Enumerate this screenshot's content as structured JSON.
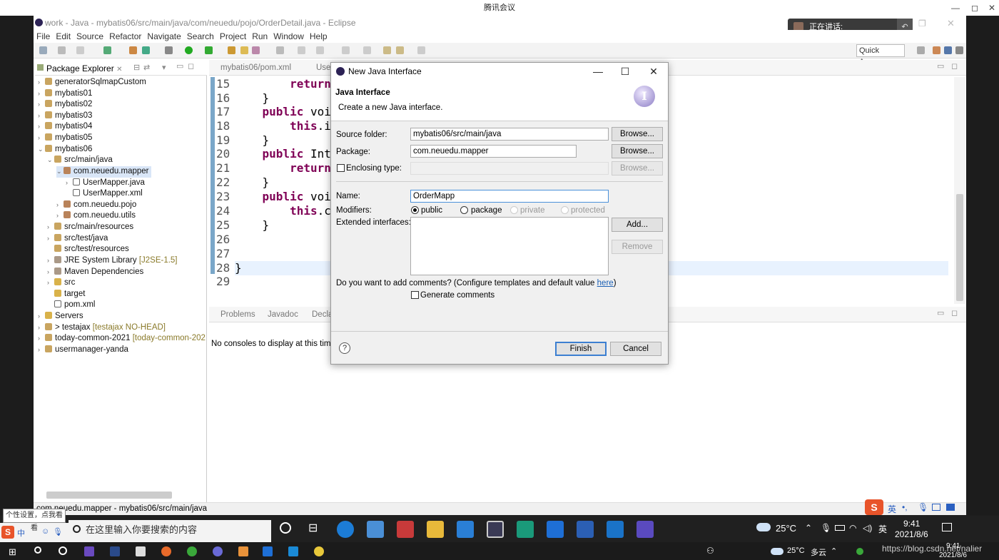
{
  "meeting": {
    "title": "腾讯会议",
    "speaking_label": "正在讲话:"
  },
  "window": {
    "title": "work - Java - mybatis06/src/main/java/com/neuedu/pojo/OrderDetail.java - Eclipse",
    "menu": [
      "File",
      "Edit",
      "Source",
      "Refactor",
      "Navigate",
      "Search",
      "Project",
      "Run",
      "Window",
      "Help"
    ],
    "quick_access": "Quick Access"
  },
  "package_explorer": {
    "tab_label": "Package Explorer",
    "items": [
      {
        "label": "generatorSqlmapCustom",
        "deco": ""
      },
      {
        "label": "mybatis01",
        "deco": ""
      },
      {
        "label": "mybatis02",
        "deco": ""
      },
      {
        "label": "mybatis03",
        "deco": ""
      },
      {
        "label": "mybatis04",
        "deco": ""
      },
      {
        "label": "mybatis05",
        "deco": ""
      },
      {
        "label": "mybatis06",
        "deco": ""
      },
      {
        "label": "src/main/java",
        "deco": ""
      },
      {
        "label": "com.neuedu.mapper",
        "deco": ""
      },
      {
        "label": "UserMapper.java",
        "deco": ""
      },
      {
        "label": "UserMapper.xml",
        "deco": ""
      },
      {
        "label": "com.neuedu.pojo",
        "deco": ""
      },
      {
        "label": "com.neuedu.utils",
        "deco": ""
      },
      {
        "label": "src/main/resources",
        "deco": ""
      },
      {
        "label": "src/test/java",
        "deco": ""
      },
      {
        "label": "src/test/resources",
        "deco": ""
      },
      {
        "label": "JRE System Library",
        "deco": "[J2SE-1.5]"
      },
      {
        "label": "Maven Dependencies",
        "deco": ""
      },
      {
        "label": "src",
        "deco": ""
      },
      {
        "label": "target",
        "deco": ""
      },
      {
        "label": "pom.xml",
        "deco": ""
      },
      {
        "label": "Servers",
        "deco": ""
      },
      {
        "label": "> testajax",
        "deco": "[testajax NO-HEAD]"
      },
      {
        "label": "today-common-2021",
        "deco": "[today-common-202"
      },
      {
        "label": "usermanager-yanda",
        "deco": ""
      }
    ]
  },
  "editor": {
    "tabs": [
      "mybatis06/pom.xml",
      "User"
    ],
    "lines": [
      {
        "n": "15",
        "code": "        return"
      },
      {
        "n": "16",
        "code": "    }"
      },
      {
        "n": "17",
        "code": "    public voi"
      },
      {
        "n": "18",
        "code": "        this.i"
      },
      {
        "n": "19",
        "code": "    }"
      },
      {
        "n": "20",
        "code": "    public Int"
      },
      {
        "n": "21",
        "code": "        return"
      },
      {
        "n": "22",
        "code": "    }"
      },
      {
        "n": "23",
        "code": "    public voi"
      },
      {
        "n": "24",
        "code": "        this.c"
      },
      {
        "n": "25",
        "code": "    }"
      },
      {
        "n": "26",
        "code": ""
      },
      {
        "n": "27",
        "code": ""
      },
      {
        "n": "28",
        "code": "}"
      },
      {
        "n": "29",
        "code": ""
      }
    ]
  },
  "console": {
    "tabs": [
      "Problems",
      "Javadoc",
      "Decla"
    ],
    "message": "No consoles to display at this time"
  },
  "status_bar": {
    "text": "com.neuedu.mapper - mybatis06/src/main/java"
  },
  "dialog": {
    "title": "New Java Interface",
    "heading": "Java Interface",
    "description": "Create a new Java interface.",
    "source_folder_label": "Source folder:",
    "source_folder_value": "mybatis06/src/main/java",
    "package_label": "Package:",
    "package_value": "com.neuedu.mapper",
    "enclosing_label": "Enclosing type:",
    "browse": "Browse...",
    "name_label": "Name:",
    "name_value": "OrderMapp",
    "modifiers_label": "Modifiers:",
    "modifiers": [
      "public",
      "package",
      "private",
      "protected"
    ],
    "extended_label": "Extended interfaces:",
    "add_label": "Add...",
    "remove_label": "Remove",
    "comments_question": "Do you want to add comments? (Configure templates and default value ",
    "here_link": "here",
    "comments_close": ")",
    "generate_comments": "Generate comments",
    "finish": "Finish",
    "cancel": "Cancel",
    "help": "?"
  },
  "taskbar": {
    "tray_tip": "个性设置，点我看看",
    "search_placeholder": "在这里输入你要搜索的内容",
    "temp": "25°C",
    "weather": "多云",
    "lang": "英",
    "time": "9:41",
    "date": "2021/8/6",
    "watermark": "https://blog.csdn.net/nalier",
    "sogou_lang": "英"
  }
}
